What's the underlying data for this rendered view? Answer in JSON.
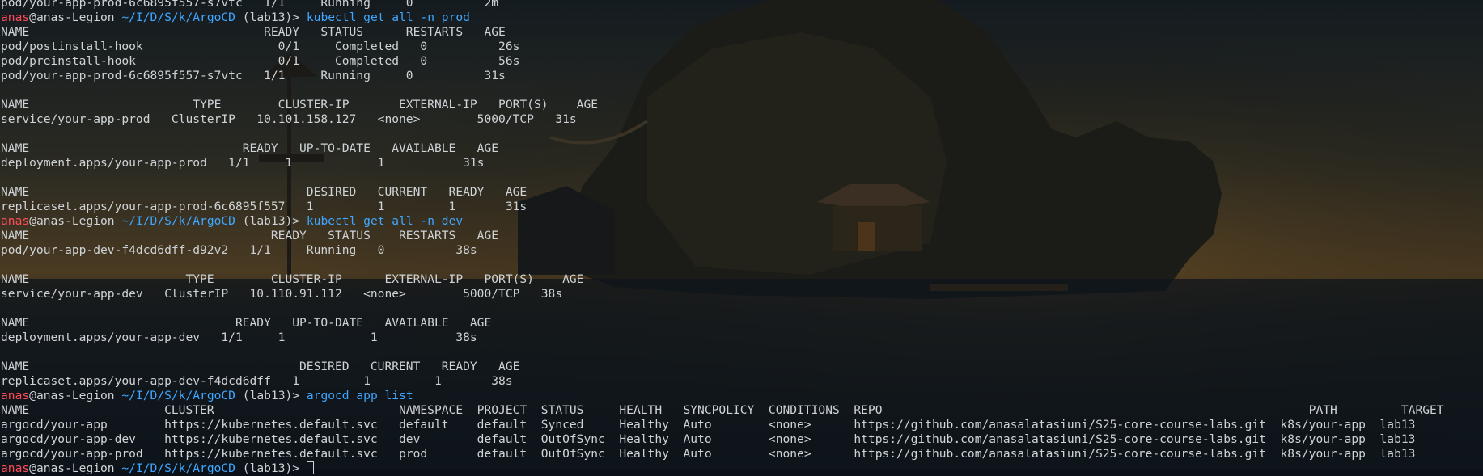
{
  "prompt": {
    "user": "anas",
    "host": "@anas-Legion",
    "cwd": "~/I/D/S/k/ArgoCD",
    "branch": "(lab13)>"
  },
  "colors": {
    "prompt_user": "#ff4b57",
    "path_and_command": "#3fa7ff",
    "output_text": "#cfd3d6"
  },
  "lines": [
    {
      "type": "out",
      "text": "pod/your-app-prod-6c6895f557-s7vtc   1/1     Running     0          2m"
    },
    {
      "type": "prompt",
      "cmd": "kubectl get all -n prod"
    },
    {
      "type": "out",
      "text": "NAME                                 READY   STATUS      RESTARTS   AGE"
    },
    {
      "type": "out",
      "text": "pod/postinstall-hook                   0/1     Completed   0          26s"
    },
    {
      "type": "out",
      "text": "pod/preinstall-hook                    0/1     Completed   0          56s"
    },
    {
      "type": "out",
      "text": "pod/your-app-prod-6c6895f557-s7vtc   1/1     Running     0          31s"
    },
    {
      "type": "out",
      "text": ""
    },
    {
      "type": "out",
      "text": "NAME                       TYPE        CLUSTER-IP       EXTERNAL-IP   PORT(S)    AGE"
    },
    {
      "type": "out",
      "text": "service/your-app-prod   ClusterIP   10.101.158.127   <none>        5000/TCP   31s"
    },
    {
      "type": "out",
      "text": ""
    },
    {
      "type": "out",
      "text": "NAME                              READY   UP-TO-DATE   AVAILABLE   AGE"
    },
    {
      "type": "out",
      "text": "deployment.apps/your-app-prod   1/1     1            1           31s"
    },
    {
      "type": "out",
      "text": ""
    },
    {
      "type": "out",
      "text": "NAME                                       DESIRED   CURRENT   READY   AGE"
    },
    {
      "type": "out",
      "text": "replicaset.apps/your-app-prod-6c6895f557   1         1         1       31s"
    },
    {
      "type": "prompt",
      "cmd": "kubectl get all -n dev"
    },
    {
      "type": "out",
      "text": "NAME                                  READY   STATUS    RESTARTS   AGE"
    },
    {
      "type": "out",
      "text": "pod/your-app-dev-f4dcd6dff-d92v2   1/1     Running   0          38s"
    },
    {
      "type": "out",
      "text": ""
    },
    {
      "type": "out",
      "text": "NAME                      TYPE        CLUSTER-IP      EXTERNAL-IP   PORT(S)    AGE"
    },
    {
      "type": "out",
      "text": "service/your-app-dev   ClusterIP   10.110.91.112   <none>        5000/TCP   38s"
    },
    {
      "type": "out",
      "text": ""
    },
    {
      "type": "out",
      "text": "NAME                             READY   UP-TO-DATE   AVAILABLE   AGE"
    },
    {
      "type": "out",
      "text": "deployment.apps/your-app-dev   1/1     1            1           38s"
    },
    {
      "type": "out",
      "text": ""
    },
    {
      "type": "out",
      "text": "NAME                                      DESIRED   CURRENT   READY   AGE"
    },
    {
      "type": "out",
      "text": "replicaset.apps/your-app-dev-f4dcd6dff   1         1         1       38s"
    },
    {
      "type": "prompt",
      "cmd": "argocd app list"
    },
    {
      "type": "out",
      "text": "NAME                   CLUSTER                          NAMESPACE  PROJECT  STATUS     HEALTH   SYNCPOLICY  CONDITIONS  REPO                                                            PATH         TARGET"
    },
    {
      "type": "out",
      "text": "argocd/your-app        https://kubernetes.default.svc   default    default  Synced     Healthy  Auto        <none>      https://github.com/anasalatasiuni/S25-core-course-labs.git  k8s/your-app  lab13"
    },
    {
      "type": "out",
      "text": "argocd/your-app-dev    https://kubernetes.default.svc   dev        default  OutOfSync  Healthy  Auto        <none>      https://github.com/anasalatasiuni/S25-core-course-labs.git  k8s/your-app  lab13"
    },
    {
      "type": "out",
      "text": "argocd/your-app-prod   https://kubernetes.default.svc   prod       default  OutOfSync  Healthy  Auto        <none>      https://github.com/anasalatasiuni/S25-core-course-labs.git  k8s/your-app  lab13"
    },
    {
      "type": "prompt",
      "cmd": "",
      "cursor": true
    }
  ]
}
